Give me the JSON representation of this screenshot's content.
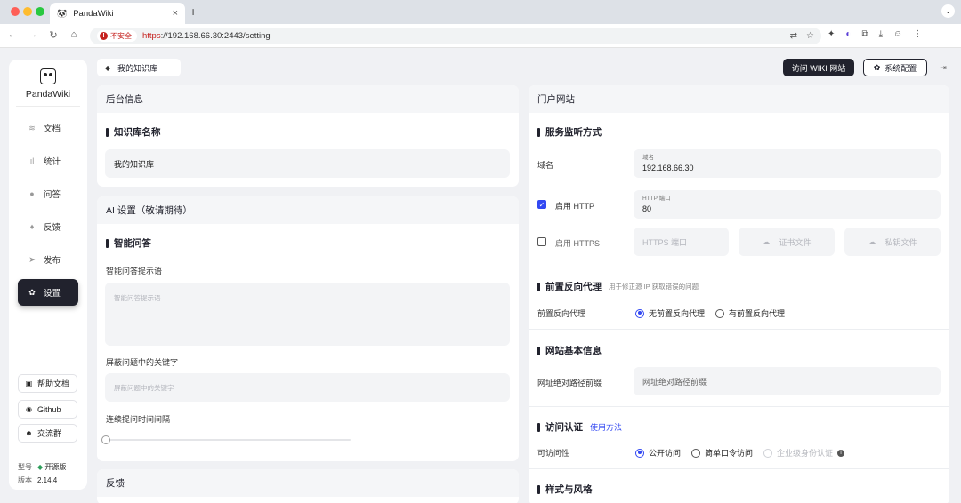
{
  "browser": {
    "tab_title": "PandaWiki",
    "security_label": "不安全",
    "url_scheme": "https",
    "url_rest": "://192.168.66.30:2443/setting"
  },
  "sidebar": {
    "brand": "PandaWiki",
    "items": [
      {
        "label": "文档",
        "icon": "layers-icon"
      },
      {
        "label": "统计",
        "icon": "bar-chart-icon"
      },
      {
        "label": "问答",
        "icon": "chat-icon"
      },
      {
        "label": "反馈",
        "icon": "bell-icon"
      },
      {
        "label": "发布",
        "icon": "send-icon"
      },
      {
        "label": "设置",
        "icon": "gear-icon"
      }
    ],
    "help_doc": "帮助文档",
    "github": "Github",
    "community": "交流群",
    "model_label": "型号",
    "model_value": "开源版",
    "version_label": "版本",
    "version_value": "2.14.4"
  },
  "header": {
    "kb_name": "我的知识库",
    "visit_wiki": "访问 WIKI 网站",
    "system_config": "系统配置"
  },
  "backend": {
    "title": "后台信息",
    "kb_name_section": "知识库名称",
    "kb_name_value": "我的知识库"
  },
  "ai": {
    "title": "AI 设置（敬请期待）",
    "smart_qa": "智能问答",
    "prompt_label": "智能问答提示语",
    "prompt_placeholder": "智能问答提示语",
    "block_label": "屏蔽问题中的关键字",
    "block_placeholder": "屏蔽问题中的关键字",
    "interval_label": "连续提问时间间隔",
    "interval_value": 0
  },
  "feedback": {
    "title": "反馈"
  },
  "portal": {
    "title": "门户网站",
    "listen_section": "服务监听方式",
    "domain_label": "域名",
    "domain_float": "域名",
    "domain_value": "192.168.66.30",
    "http_label": "启用 HTTP",
    "http_enabled": true,
    "http_port_float": "HTTP 端口",
    "http_port_value": "80",
    "https_label": "启用 HTTPS",
    "https_enabled": false,
    "https_port_placeholder": "HTTPS 端口",
    "cert_file": "证书文件",
    "key_file": "私钥文件",
    "proxy_section": "前置反向代理",
    "proxy_hint": "用于修正源 IP 获取错误的问题",
    "proxy_label": "前置反向代理",
    "proxy_options": [
      "无前置反向代理",
      "有前置反向代理"
    ],
    "proxy_selected": "无前置反向代理",
    "site_section": "网站基本信息",
    "site_prefix_label": "网址绝对路径前缀",
    "site_prefix_placeholder": "网址绝对路径前缀",
    "auth_section": "访问认证",
    "auth_link": "使用方法",
    "access_label": "可访问性",
    "access_options": [
      "公开访问",
      "简单口令访问",
      "企业级身份认证"
    ],
    "access_selected": "公开访问",
    "style_section": "样式与风格"
  }
}
